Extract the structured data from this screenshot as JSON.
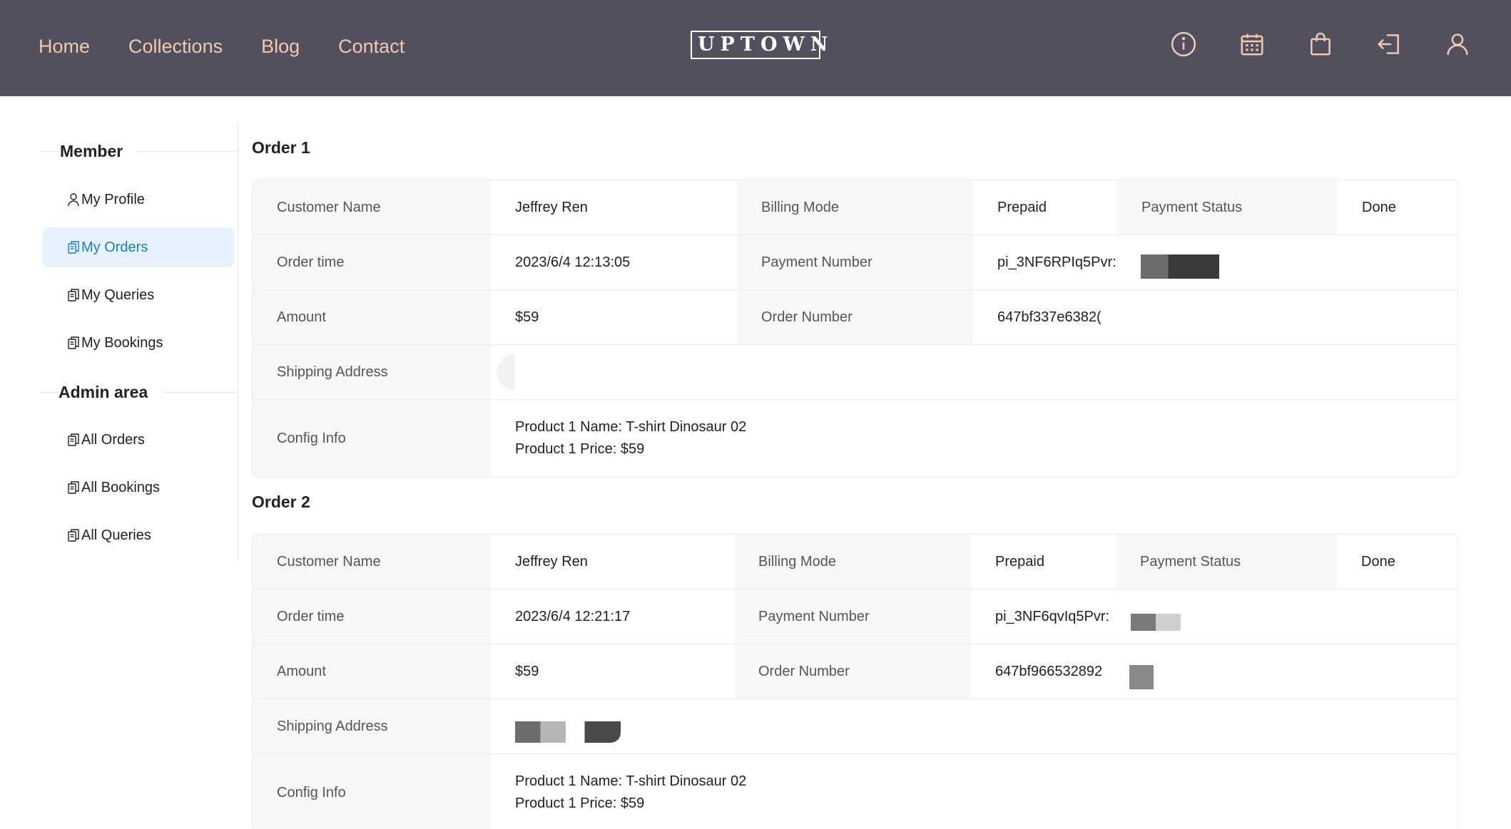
{
  "nav": {
    "items": [
      "Home",
      "Collections",
      "Blog",
      "Contact"
    ]
  },
  "brand": {
    "logo": "UPTOWN"
  },
  "header_icons": [
    "info-icon",
    "calendar-icon",
    "shopping-bag-icon",
    "logout-icon",
    "user-icon"
  ],
  "colors": {
    "header_bg": "#52505f",
    "nav_text": "#f0c9b0",
    "active_bg": "#e6f2fd",
    "active_text": "#1f7ad1"
  },
  "sidebar": {
    "member_title": "Member",
    "member_items": [
      "My Profile",
      "My Orders",
      "My Queries",
      "My Bookings"
    ],
    "admin_title": "Admin area",
    "admin_items": [
      "All Orders",
      "All Bookings",
      "All Queries"
    ],
    "active_item": "My Orders"
  },
  "orders": [
    {
      "title": "Order 1",
      "labels": {
        "customer_name": "Customer Name",
        "billing_mode": "Billing Mode",
        "payment_status": "Payment Status",
        "order_time": "Order time",
        "payment_number": "Payment Number",
        "amount": "Amount",
        "order_number": "Order Number",
        "shipping_address": "Shipping Address",
        "config_info": "Config Info"
      },
      "customer_name": "Jeffrey Ren",
      "billing_mode": "Prepaid",
      "payment_status": "Done",
      "order_time": "2023/6/4 12:13:05",
      "payment_number": "pi_3NF6RPIq5Pvr:",
      "amount": "$59",
      "order_number": "647bf337e6382(",
      "shipping_address": "",
      "config_line1": "Product 1 Name: T-shirt Dinosaur 02",
      "config_line2": "Product 1 Price: $59"
    },
    {
      "title": "Order 2",
      "labels": {
        "customer_name": "Customer Name",
        "billing_mode": "Billing Mode",
        "payment_status": "Payment Status",
        "order_time": "Order time",
        "payment_number": "Payment Number",
        "amount": "Amount",
        "order_number": "Order Number",
        "shipping_address": "Shipping Address",
        "config_info": "Config Info"
      },
      "customer_name": "Jeffrey Ren",
      "billing_mode": "Prepaid",
      "payment_status": "Done",
      "order_time": "2023/6/4 12:21:17",
      "payment_number": "pi_3NF6qvIq5Pvr:",
      "amount": "$59",
      "order_number": "647bf966532892",
      "shipping_address": "",
      "config_line1": "Product 1 Name: T-shirt Dinosaur 02",
      "config_line2": "Product 1 Price: $59"
    }
  ]
}
